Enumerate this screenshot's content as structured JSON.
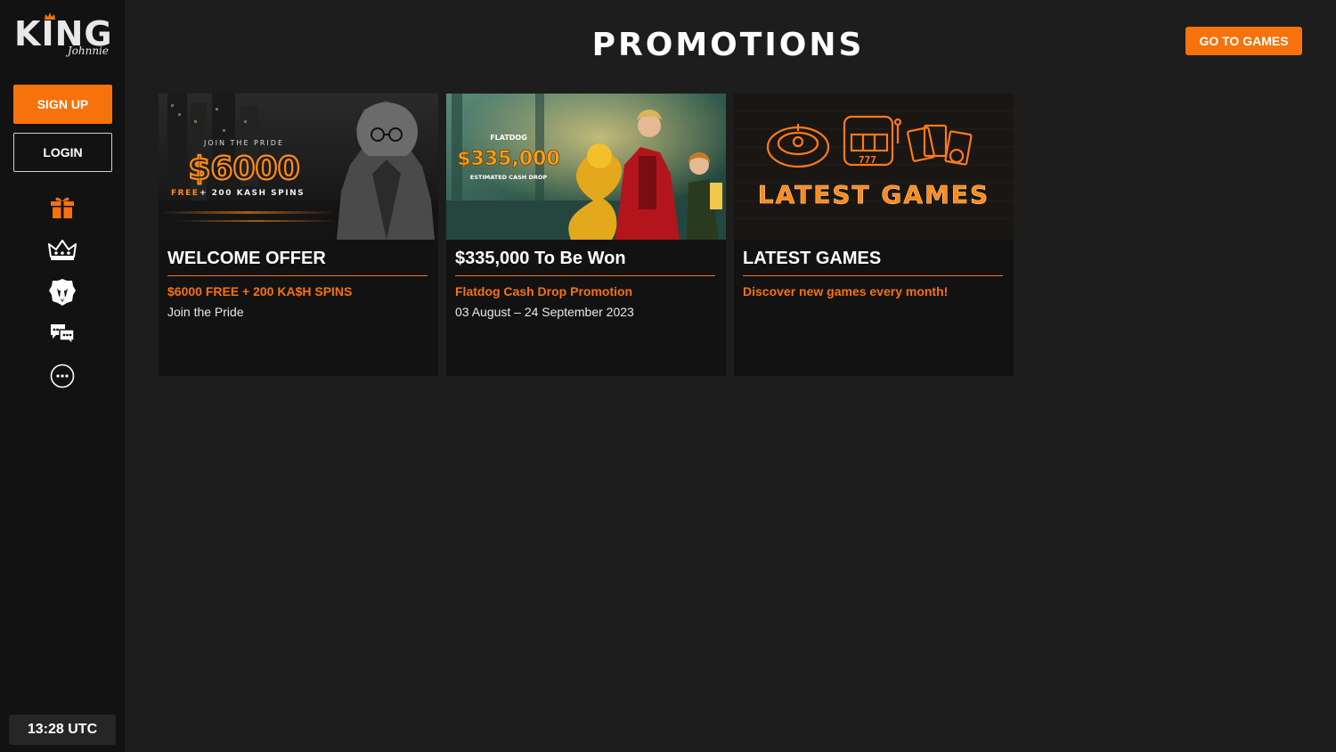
{
  "brand": {
    "logo_main": "KING",
    "logo_sub": "Johnnie"
  },
  "sidebar": {
    "signup_label": "SIGN UP",
    "login_label": "LOGIN",
    "icons": [
      "gift-icon",
      "crown-icon",
      "lion-icon",
      "chat-icon",
      "more-icon"
    ],
    "clock": "13:28 UTC"
  },
  "header": {
    "title": "PROMOTIONS",
    "go_to_games_label": "GO TO GAMES"
  },
  "colors": {
    "accent": "#f7720c",
    "background": "#1d1d1d",
    "sidebar": "#121212"
  },
  "promotions": [
    {
      "title": "WELCOME OFFER",
      "subtitle": "$6000 FREE + 200 KA$H SPINS",
      "description": "Join the Pride",
      "banner": {
        "kicker": "JOIN THE PRIDE",
        "amount": "$6000",
        "line1": "FREE",
        "line2": "+ 200 KASH SPINS"
      }
    },
    {
      "title": "$335,000 To Be Won",
      "subtitle": "Flatdog Cash Drop Promotion",
      "description": "03 August – 24 September 2023",
      "banner": {
        "brand": "FLATDOG",
        "amount": "$335,000",
        "caption": "ESTIMATED CASH DROP"
      }
    },
    {
      "title": "LATEST GAMES",
      "subtitle": "Discover new games every month!",
      "description": "",
      "banner": {
        "headline": "LATEST GAMES",
        "slot": "777"
      }
    }
  ]
}
